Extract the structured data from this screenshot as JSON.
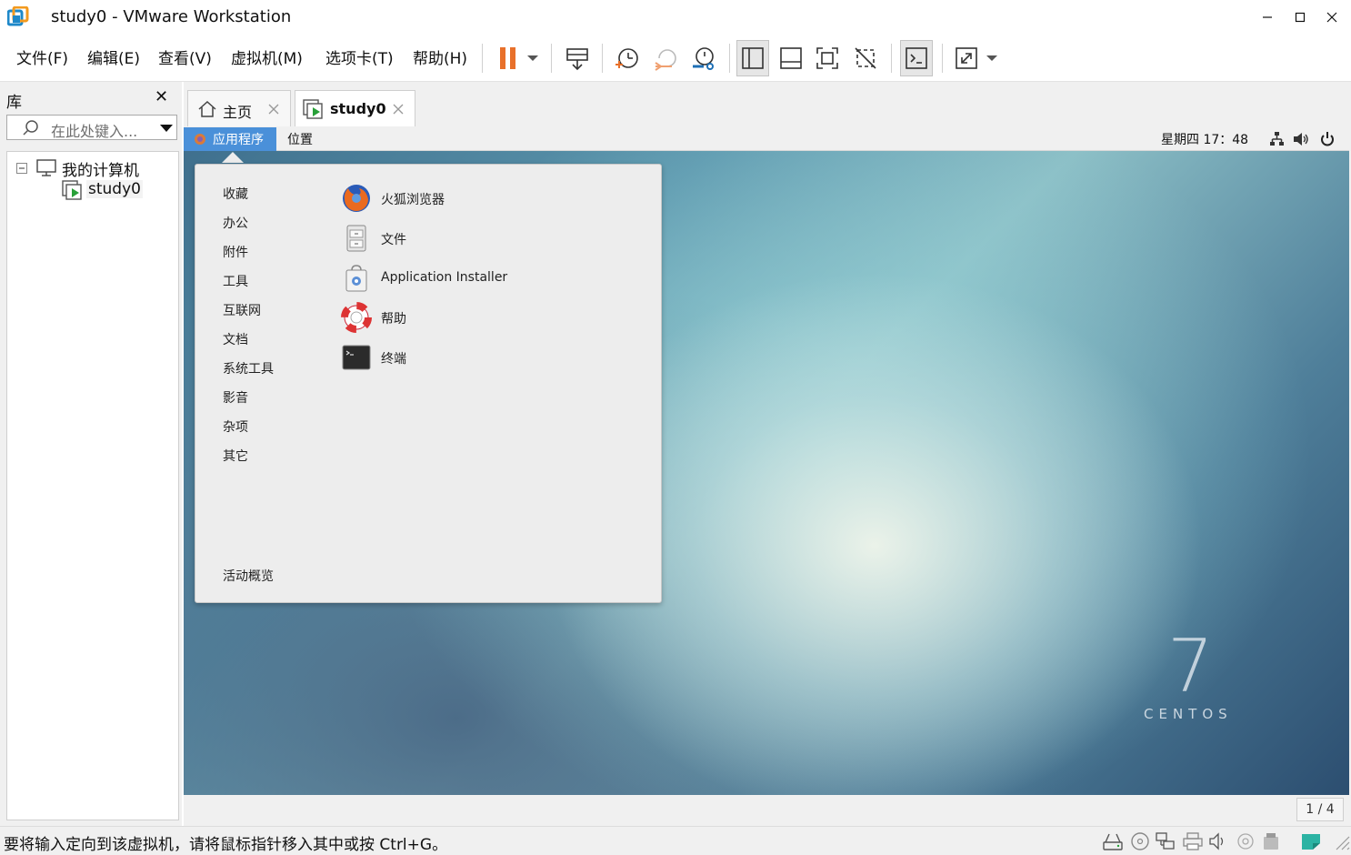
{
  "window": {
    "title": "study0 - VMware Workstation"
  },
  "menubar": {
    "items": [
      "文件(F)",
      "编辑(E)",
      "查看(V)",
      "虚拟机(M)",
      "选项卡(T)",
      "帮助(H)"
    ]
  },
  "toolbar": {
    "icons": [
      "pause-icon",
      "dropdown-icon",
      "send-ctrl-alt-del-icon",
      "snapshot-icon",
      "revert-snapshot-icon",
      "snapshot-manager-icon",
      "show-library-icon",
      "show-thumbnail-icon",
      "fullscreen-icon",
      "unity-icon",
      "console-icon",
      "stretch-icon",
      "dropdown-icon"
    ],
    "accent_color": "#e8702a"
  },
  "library": {
    "header": "库",
    "close": "✕",
    "search_placeholder": "在此处键入...",
    "tree": {
      "root": "我的计算机",
      "children": [
        "study0"
      ]
    }
  },
  "tabs": [
    {
      "label": "主页",
      "icon": "home-icon"
    },
    {
      "label": "study0",
      "icon": "vm-icon"
    }
  ],
  "guest": {
    "topbar": {
      "applications": "应用程序",
      "places": "位置",
      "clock": "星期四 17：48"
    },
    "categories": [
      "收藏",
      "办公",
      "附件",
      "工具",
      "互联网",
      "文档",
      "系统工具",
      "影音",
      "杂项",
      "其它"
    ],
    "activities": "活动概览",
    "apps": [
      {
        "label": "火狐浏览器",
        "icon": "firefox-icon"
      },
      {
        "label": "文件",
        "icon": "files-icon"
      },
      {
        "label": "Application Installer",
        "icon": "installer-icon"
      },
      {
        "label": "帮助",
        "icon": "help-lifebuoy-icon"
      },
      {
        "label": "终端",
        "icon": "terminal-icon"
      }
    ],
    "wallpaper": {
      "number": "7",
      "brand": "CENTOS"
    },
    "workspace_indicator": "1 / 4",
    "selected_color": "#4a90d9"
  },
  "statusbar": {
    "message": "要将输入定向到该虚拟机，请将鼠标指针移入其中或按 Ctrl+G。"
  }
}
